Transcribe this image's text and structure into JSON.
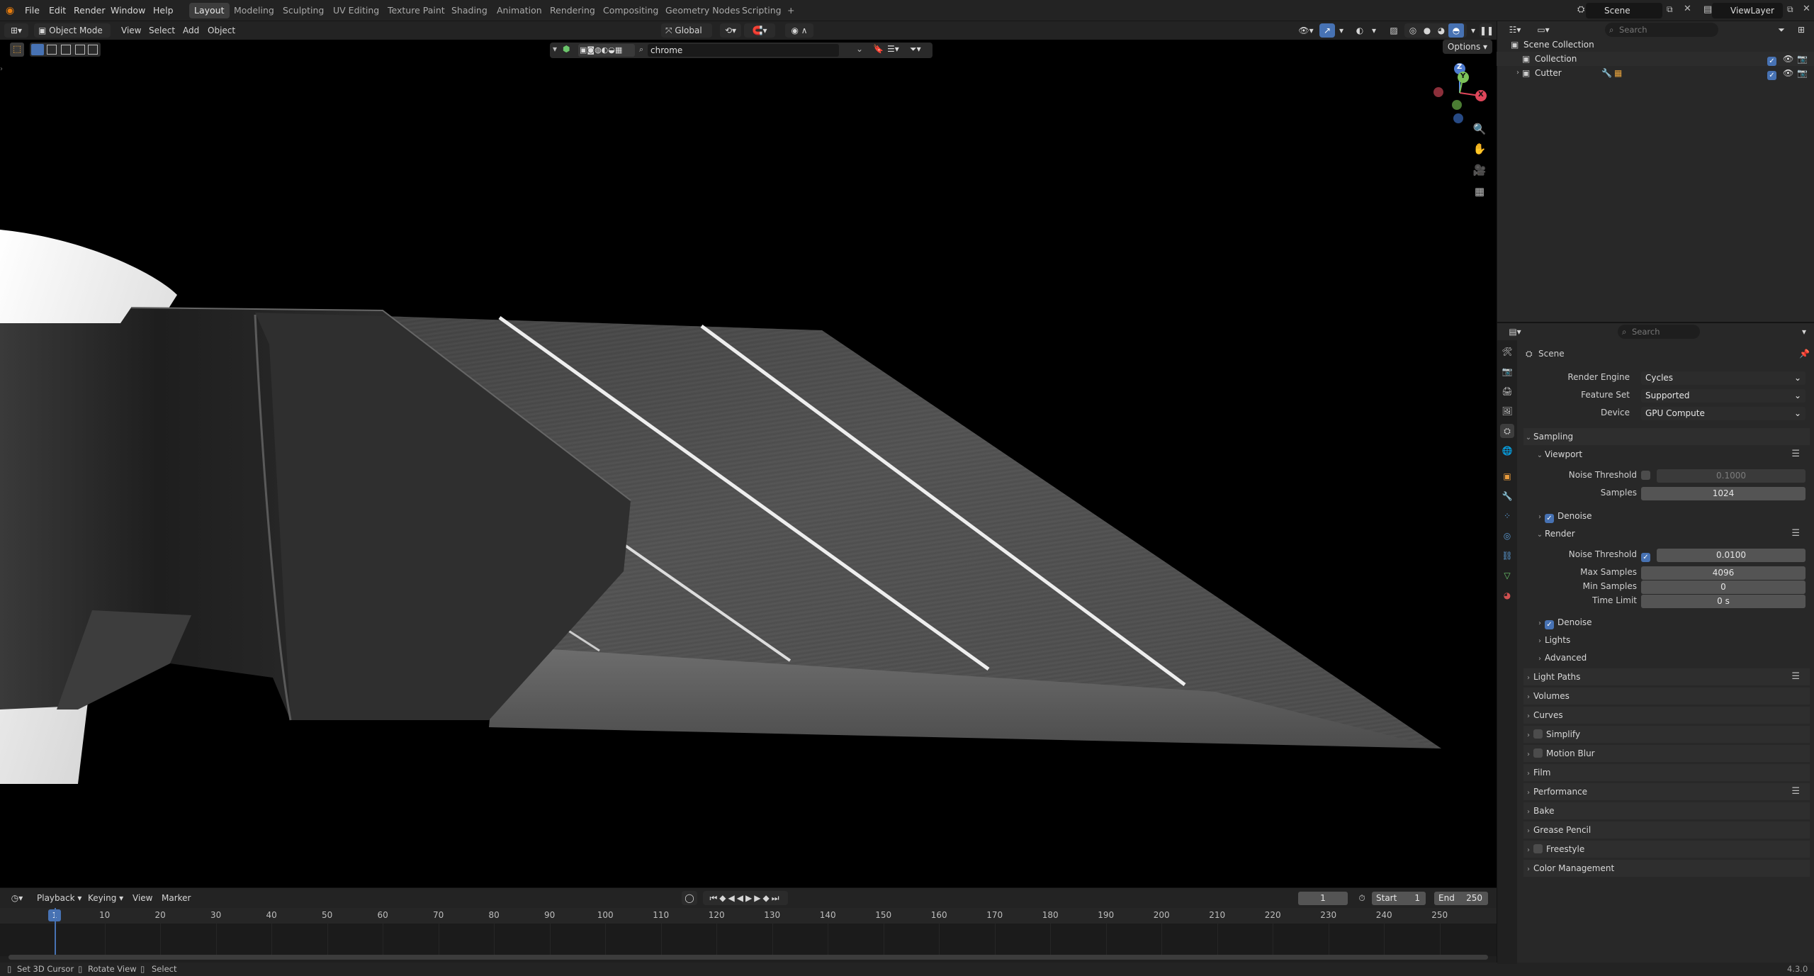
{
  "topbar": {
    "menus": [
      "File",
      "Edit",
      "Render",
      "Window",
      "Help"
    ],
    "workspaces": [
      "Layout",
      "Modeling",
      "Sculpting",
      "UV Editing",
      "Texture Paint",
      "Shading",
      "Animation",
      "Rendering",
      "Compositing",
      "Geometry Nodes",
      "Scripting"
    ],
    "active_workspace": "Layout",
    "add_tab": "+",
    "scene": "Scene",
    "view_layer": "ViewLayer"
  },
  "viewport_header": {
    "mode": "Object Mode",
    "menus": [
      "View",
      "Select",
      "Add",
      "Object"
    ],
    "orientation": "Global",
    "search_value": "chrome",
    "options": "Options"
  },
  "gizmo": {
    "z": "Z",
    "y": "Y",
    "x": "X"
  },
  "timeline": {
    "menus": [
      "Playback",
      "Keying",
      "View",
      "Marker"
    ],
    "current_frame": "1",
    "start_label": "Start",
    "start": "1",
    "end_label": "End",
    "end": "250",
    "ruler_frame": "1",
    "ticks": [
      "10",
      "20",
      "30",
      "40",
      "50",
      "60",
      "70",
      "80",
      "90",
      "100",
      "110",
      "120",
      "130",
      "140",
      "150",
      "160",
      "170",
      "180",
      "190",
      "200",
      "210",
      "220",
      "230",
      "240",
      "250"
    ]
  },
  "status": {
    "items": [
      "Set 3D Cursor",
      "Rotate View",
      "Select"
    ],
    "version": "4.3.0"
  },
  "outliner": {
    "search_placeholder": "Search",
    "root": "Scene Collection",
    "items": [
      "Collection",
      "Cutter"
    ]
  },
  "properties": {
    "search_placeholder": "Search",
    "context": "Scene",
    "render_engine_label": "Render Engine",
    "render_engine": "Cycles",
    "feature_set_label": "Feature Set",
    "feature_set": "Supported",
    "device_label": "Device",
    "device": "GPU Compute",
    "sampling": "Sampling",
    "viewport": "Viewport",
    "noise_threshold_label": "Noise Threshold",
    "viewport_noise_threshold": "0.1000",
    "samples_label": "Samples",
    "viewport_samples": "1024",
    "denoise": "Denoise",
    "render": "Render",
    "render_noise_threshold": "0.0100",
    "max_samples_label": "Max Samples",
    "max_samples": "4096",
    "min_samples_label": "Min Samples",
    "min_samples": "0",
    "time_limit_label": "Time Limit",
    "time_limit": "0 s",
    "lights": "Lights",
    "advanced": "Advanced",
    "panels": [
      "Light Paths",
      "Volumes",
      "Curves",
      "Simplify",
      "Motion Blur",
      "Film",
      "Performance",
      "Bake",
      "Grease Pencil",
      "Freestyle",
      "Color Management"
    ]
  }
}
